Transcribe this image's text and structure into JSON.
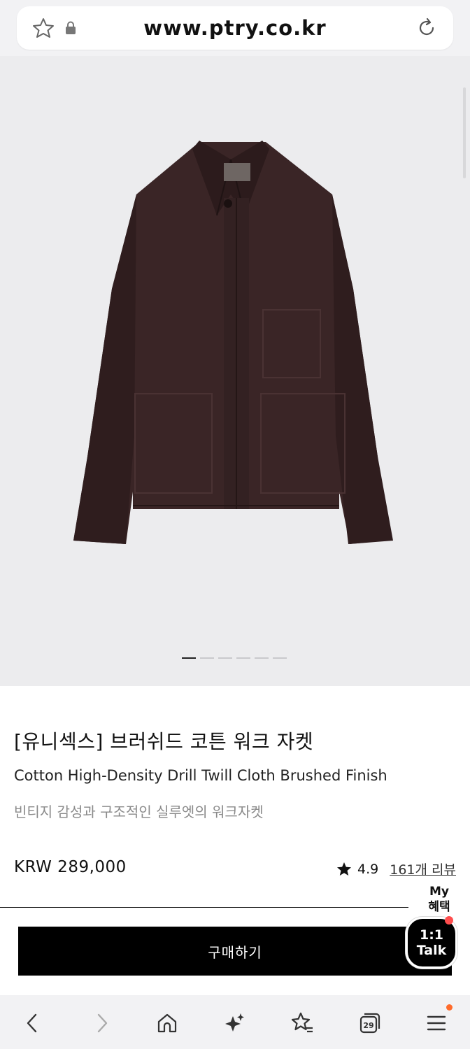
{
  "browser": {
    "url": "www.ptry.co.kr",
    "tab_count": "29"
  },
  "gallery": {
    "image_count": 6,
    "active_index": 0
  },
  "product": {
    "title": "[유니섹스] 브러쉬드 코튼 워크 자켓",
    "subtitle": "Cotton High-Density Drill Twill Cloth Brushed Finish",
    "description": "빈티지 감성과 구조적인 실루엣의 워크자켓",
    "price": "KRW 289,000",
    "rating": "4.9",
    "reviews_label": "161개 리뷰"
  },
  "benefit": {
    "line1": "My",
    "line2": "혜택"
  },
  "actions": {
    "buy_label": "구매하기",
    "talk_line1": "1:1",
    "talk_line2": "Talk"
  },
  "colors": {
    "jacket": "#3a2526",
    "button": "#000000",
    "badge": "#ff4d4d"
  }
}
